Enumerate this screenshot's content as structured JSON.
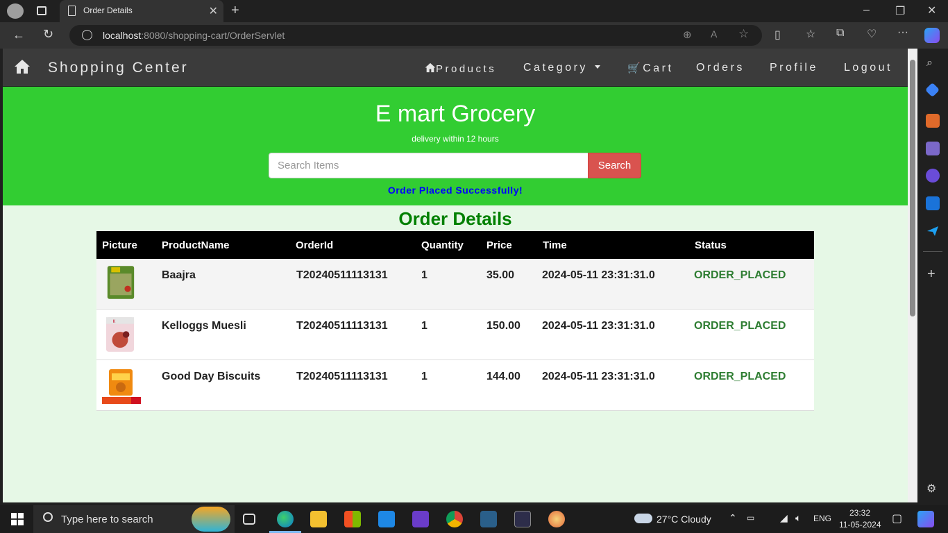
{
  "browser": {
    "tab_title": "Order Details",
    "url_host": "localhost",
    "url_rest": ":8080/shopping-cart/OrderServlet"
  },
  "navbar": {
    "brand": "Shopping Center",
    "items": {
      "products": "Products",
      "category": "Category",
      "cart": "Cart",
      "orders": "Orders",
      "profile": "Profile",
      "logout": "Logout"
    }
  },
  "hero": {
    "title": "E mart Grocery",
    "subtitle": "delivery within 12 hours",
    "search_placeholder": "Search Items",
    "search_button": "Search",
    "message": "Order Placed Successfully!"
  },
  "order_table": {
    "title": "Order Details",
    "headers": [
      "Picture",
      "ProductName",
      "OrderId",
      "Quantity",
      "Price",
      "Time",
      "Status"
    ],
    "rows": [
      {
        "name": "Baajra",
        "order_id": "T20240511113131",
        "quantity": "1",
        "price": "35.00",
        "time": "2024-05-11 23:31:31.0",
        "status": "ORDER_PLACED"
      },
      {
        "name": "Kelloggs Muesli",
        "order_id": "T20240511113131",
        "quantity": "1",
        "price": "150.00",
        "time": "2024-05-11 23:31:31.0",
        "status": "ORDER_PLACED"
      },
      {
        "name": "Good Day Biscuits",
        "order_id": "T20240511113131",
        "quantity": "1",
        "price": "144.00",
        "time": "2024-05-11 23:31:31.0",
        "status": "ORDER_PLACED"
      }
    ]
  },
  "taskbar": {
    "search_placeholder": "Type here to search",
    "weather": "27°C  Cloudy",
    "language": "ENG",
    "time": "23:32",
    "date": "11-05-2024"
  },
  "colors": {
    "hero_bg": "#32cd32",
    "navbar_bg": "#3b3b3b",
    "page_bg": "#e6f8e6",
    "search_button_bg": "#d9534f",
    "message_color": "#0000ff",
    "title_color": "#008000",
    "status_color": "#2e7d32"
  }
}
